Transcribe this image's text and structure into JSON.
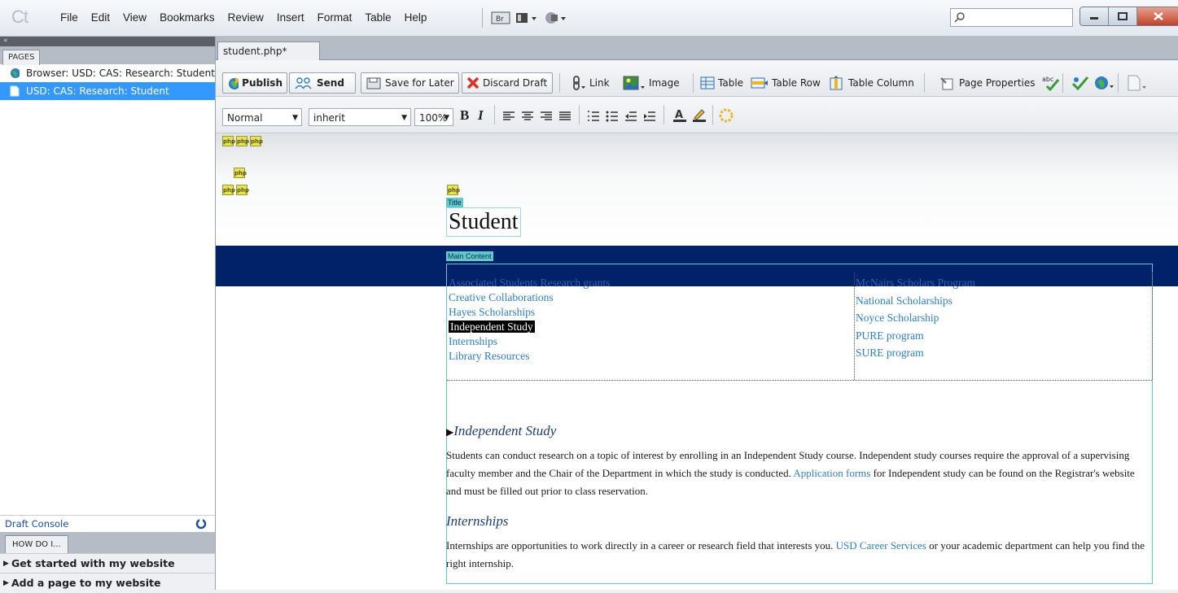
{
  "menubar": {
    "logo": "Ct",
    "items": [
      "File",
      "Edit",
      "View",
      "Bookmarks",
      "Review",
      "Insert",
      "Format",
      "Table",
      "Help"
    ],
    "bridge_label": "Br"
  },
  "left": {
    "collapse": "«",
    "pages_tab": "PAGES",
    "pages": [
      {
        "label": "Browser: USD: CAS: Research: Student",
        "selected": false
      },
      {
        "label": "USD: CAS: Research: Student",
        "selected": true
      }
    ],
    "draft_console": "Draft Console",
    "how_tab": "HOW DO I...",
    "how_items": [
      "Get started with my website",
      "Add a page to my website"
    ]
  },
  "editor": {
    "doc_tab": "student.php*",
    "toolbar1": {
      "publish": "Publish",
      "send": "Send",
      "save_later": "Save for Later",
      "discard": "Discard Draft",
      "link": "Link",
      "image": "Image",
      "table": "Table",
      "table_row": "Table Row",
      "table_column": "Table Column",
      "page_properties": "Page Properties",
      "spell": "abc"
    },
    "toolbar2": {
      "style": "Normal",
      "font": "inherit",
      "size": "100%",
      "bold": "B",
      "italic": "I"
    }
  },
  "page": {
    "php_badge": "php",
    "title_label": "Title",
    "title": "Student",
    "main_label": "Main Content",
    "left_links": [
      {
        "text": "Associated Students Research grants",
        "style": "dim"
      },
      {
        "text": "Creative Collaborations",
        "style": ""
      },
      {
        "text": "Hayes Scholarships",
        "style": ""
      },
      {
        "text": "Independent Study",
        "style": "hl"
      },
      {
        "text": "Internships",
        "style": ""
      },
      {
        "text": "Library Resources",
        "style": ""
      }
    ],
    "right_links": [
      {
        "text": "McNairs Scholars Program",
        "style": "dim"
      },
      {
        "text": "National Scholarships",
        "style": ""
      },
      {
        "text": "Noyce Scholarship",
        "style": ""
      },
      {
        "text": "PURE program",
        "style": ""
      },
      {
        "text": "SURE program",
        "style": ""
      }
    ],
    "section1": {
      "heading": "Independent Study",
      "p_a": "Students can conduct research on a topic of interest by enrolling in an Independent Study course. Independent study courses require the approval of a supervising faculty member and the Chair of the Department in which the study is conducted. ",
      "p_link": "Application forms",
      "p_b": " for Independent study can be found on the Registrar's website and must be filled out prior to class reservation."
    },
    "section2": {
      "heading": "Internships",
      "p_a": "Internships are opportunities to work directly in a career or research field that interests you. ",
      "p_link": "USD Career Services",
      "p_b": " or your academic department can help you find the right internship."
    }
  }
}
